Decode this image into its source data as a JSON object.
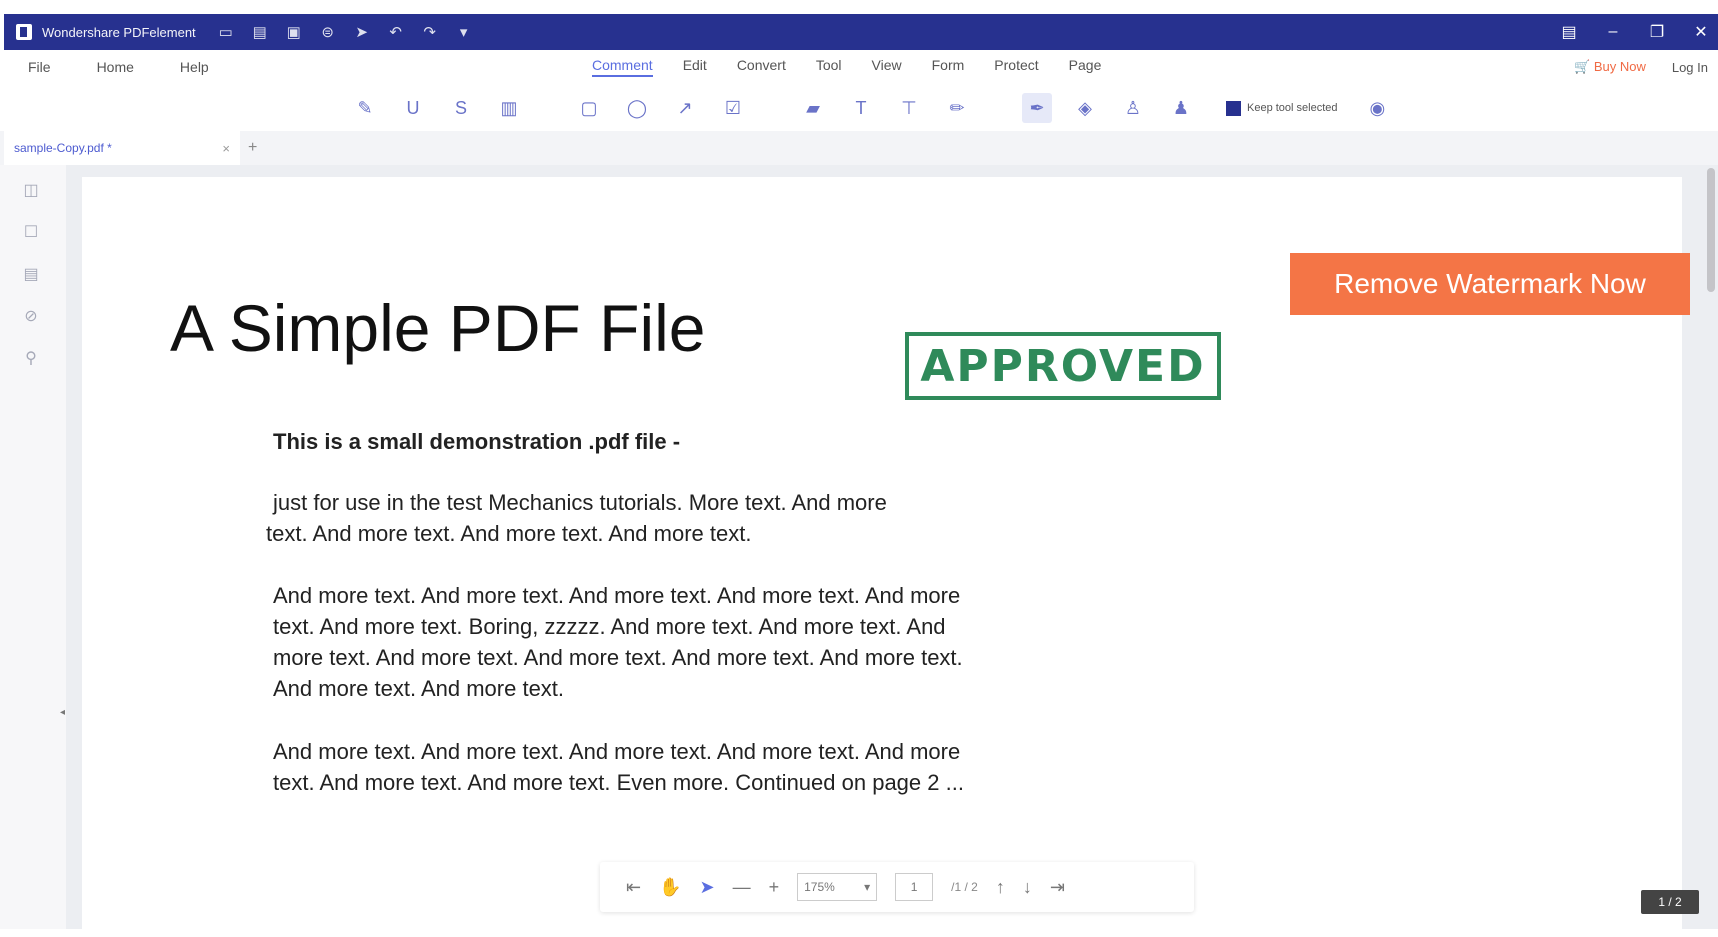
{
  "titlebar": {
    "app_title": "Wondershare PDFelement",
    "quick_actions": [
      "open-icon",
      "save-icon",
      "save-as-icon",
      "print-icon",
      "share-icon",
      "undo-icon",
      "redo-icon",
      "customize-icon"
    ]
  },
  "menu": {
    "left": [
      "File",
      "Home",
      "Help"
    ],
    "center": [
      "Comment",
      "Edit",
      "Convert",
      "Tool",
      "View",
      "Form",
      "Protect",
      "Page"
    ],
    "active": "Comment",
    "buy_now": "Buy Now",
    "login": "Log In"
  },
  "toolbar": {
    "keep_tool_label": "Keep tool selected"
  },
  "tab": {
    "name": "sample-Copy.pdf *"
  },
  "document": {
    "title": "A Simple PDF File",
    "stamp": "APPROVED",
    "watermark_button": "Remove Watermark Now",
    "paragraphs": [
      "This is a small demonstration .pdf file -",
      "just for use in the test Mechanics tutorials. More text. And more",
      "text. And more text. And more text. And more text.",
      "And more text. And more text. And more text. And more text. And more",
      "text. And more text. Boring, zzzzz. And more text. And more text. And",
      "more text. And more text. And more text. And more text. And more text.",
      "And more text. And more text.",
      "And more text. And more text. And more text. And more text. And more",
      "text. And more text. And more text. Even more. Continued on page 2 ..."
    ]
  },
  "navbar": {
    "zoom": "175%",
    "page_current": "1",
    "page_total": "/1 / 2",
    "page_badge": "1 / 2"
  },
  "colors": {
    "titlebar": "#27318f",
    "accent": "#5a6ee0",
    "stamp": "#2f8a5a",
    "watermark": "#f47546"
  }
}
